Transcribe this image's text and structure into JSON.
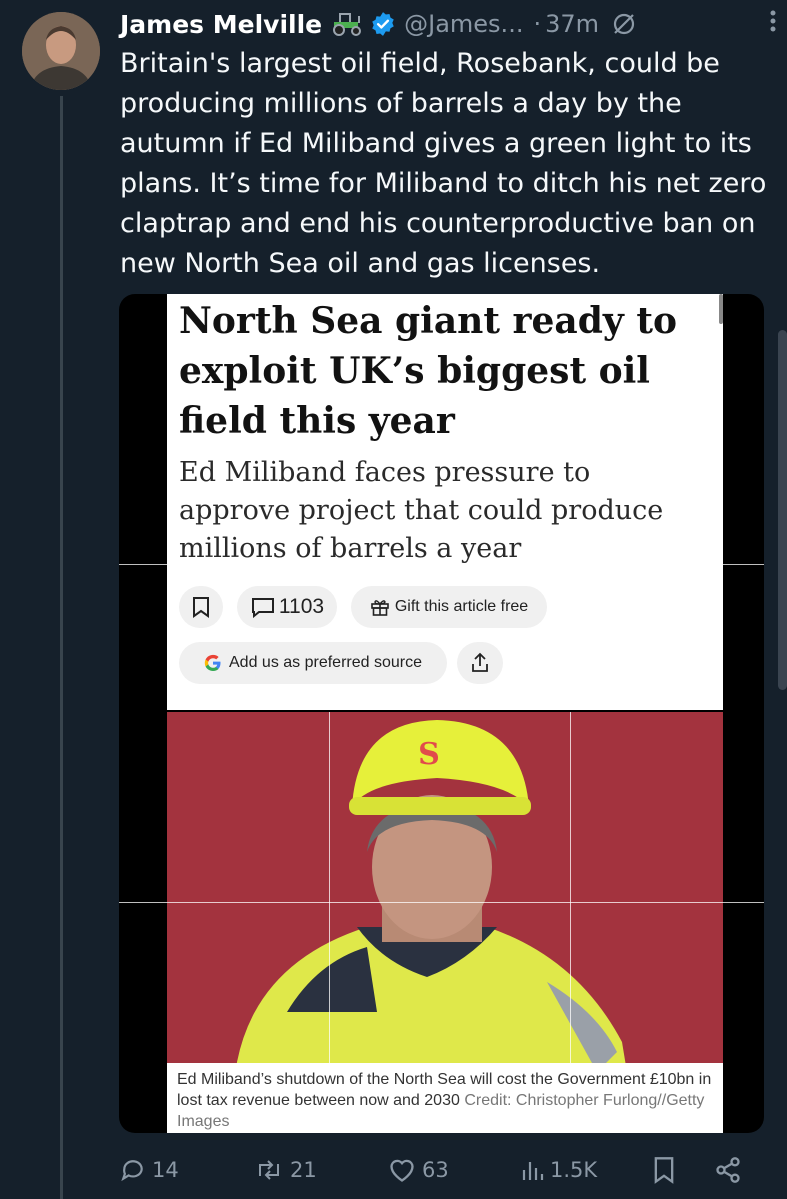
{
  "tweet": {
    "author_name": "James Melville",
    "handle": "@James...",
    "separator": "·",
    "time": "37m",
    "text": "Britain's largest oil field, Rosebank, could be producing millions of barrels a day by the autumn if Ed Miliband gives a green light to its plans. It’s time for Miliband to ditch his net zero claptrap and end his counterproductive ban on new North Sea oil and gas licenses.",
    "icons": [
      "tractor-icon",
      "verified-badge-icon",
      "no-entry-icon",
      "more-options-icon"
    ]
  },
  "article": {
    "headline": "North Sea giant ready to exploit UK’s biggest oil field this year",
    "standfirst": "Ed Miliband faces pressure to approve project that could produce millions of barrels a year",
    "comment_count": "1103",
    "gift_label": "Gift this article free",
    "preferred_source_label": "Add us as preferred source",
    "caption": "Ed Miliband’s shutdown of the North Sea will cost the Government £10bn in lost tax revenue between now and 2030",
    "credit": "Credit: Christopher Furlong//Getty Images",
    "photo_badge": "S"
  },
  "actions": {
    "replies": "14",
    "reposts": "21",
    "likes": "63",
    "views": "1.5K"
  },
  "colors": {
    "background": "#15202b",
    "text": "#f5f8fa",
    "muted": "#8b98a5",
    "verified": "#1d9bf0",
    "photo_background": "#a3333e",
    "helmet": "#e6f03a"
  }
}
